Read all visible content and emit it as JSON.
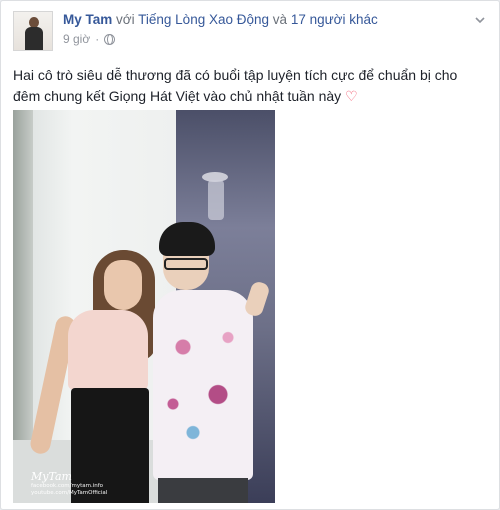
{
  "post": {
    "author": "My Tam",
    "with_word": "với",
    "tagged_page": "Tiếng Lòng Xao Động",
    "and_word": "và",
    "others_label": "17 người khác",
    "timestamp": "9 giờ",
    "separator": "·",
    "privacy_icon": "globe-icon",
    "options_icon": "chevron-down-icon",
    "message": "Hai cô trò siêu dễ thương đã có buổi tập luyện tích cực để chuẩn bị cho đêm chung kết Giọng Hát Việt vào chủ nhật tuần này",
    "message_emoji": "♡",
    "photo": {
      "signature": "MyTam",
      "credits": [
        "facebook.com/mytam.info",
        "youtube.com/MyTamOfficial"
      ]
    }
  },
  "colors": {
    "link": "#365899",
    "meta": "#90949c",
    "text": "#1d2129",
    "heart": "#f25268"
  }
}
